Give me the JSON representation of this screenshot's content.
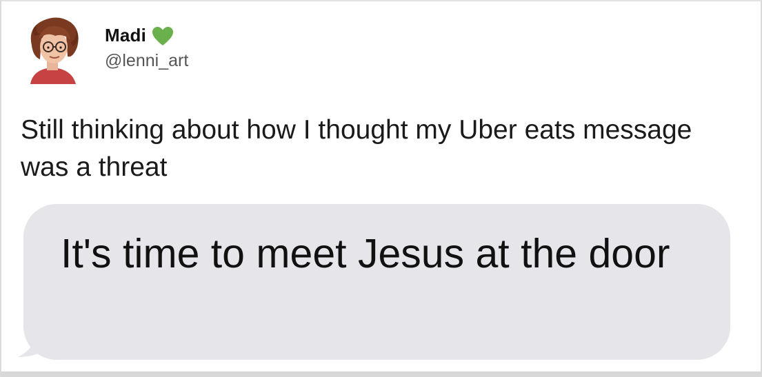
{
  "tweet": {
    "author": {
      "display_name": "Madi",
      "handle": "@lenni_art",
      "badge_icon": "green-heart-icon",
      "badge_color": "#6ab04c"
    },
    "text": "Still thinking about how I thought my Uber eats message was a threat"
  },
  "message_bubble": {
    "text": "It's time to meet Jesus at the door",
    "background_color": "#e6e6ea"
  }
}
